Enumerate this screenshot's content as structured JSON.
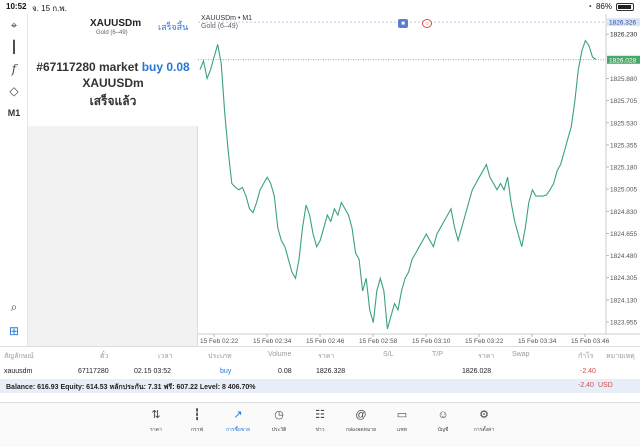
{
  "status": {
    "time": "10:52",
    "date": "จ. 15 ก.พ.",
    "battery": "86%"
  },
  "left_toolbar": {
    "tools": [
      "crosshair-icon",
      "candlestick-icon",
      "function-icon",
      "objects-icon"
    ],
    "timeframe": "M1"
  },
  "order_panel": {
    "symbol": "XAUUSDm",
    "symbol_desc": "Gold (6–49)",
    "done_label": "เสร็จสิ้น",
    "order_prefix": "#67117280 market",
    "order_type": "buy 0.08",
    "order_symbol": "XAUUSDm",
    "order_status": "เสร็จแล้ว"
  },
  "chart": {
    "header_line1": "XAUUSDm • M1",
    "header_line2": "Gold (6–49)",
    "current_price": "1826.028"
  },
  "chart_data": {
    "type": "line",
    "price_labels": [
      "1826.326",
      "1826.230",
      "1826.028",
      "1825.880",
      "1825.705",
      "1825.530",
      "1825.355",
      "1825.180",
      "1825.005",
      "1824.830",
      "1824.655",
      "1824.480",
      "1824.305",
      "1824.130",
      "1823.955"
    ],
    "time_labels": [
      "15 Feb 02:22",
      "15 Feb 02:34",
      "15 Feb 02:46",
      "15 Feb 02:58",
      "15 Feb 03:10",
      "15 Feb 03:22",
      "15 Feb 03:34",
      "15 Feb 03:46"
    ],
    "ylim": [
      1823.86,
      1826.39
    ],
    "price_ticks": [
      1826.23,
      1826.055,
      1825.88,
      1825.705,
      1825.53,
      1825.355,
      1825.18,
      1825.005,
      1824.83,
      1824.655,
      1824.48,
      1824.305,
      1824.13,
      1823.955
    ],
    "current_price": 1826.028,
    "series": [
      {
        "values": [
          1825.95,
          1826.02,
          1825.88,
          1825.95,
          1826.05,
          1826.15,
          1826.0,
          1825.6,
          1825.3,
          1825.05,
          1825.02,
          1825.0,
          1825.02,
          1824.95,
          1824.85,
          1824.82,
          1824.9,
          1825.0,
          1825.05,
          1825.1,
          1825.05,
          1824.95,
          1824.7,
          1824.6,
          1824.55,
          1824.45,
          1824.35,
          1824.3,
          1824.45,
          1824.7,
          1824.88,
          1824.8,
          1824.65,
          1824.55,
          1824.6,
          1824.7,
          1824.8,
          1824.75,
          1824.85,
          1824.8,
          1824.9,
          1824.85,
          1824.8,
          1824.7,
          1824.5,
          1824.45,
          1824.2,
          1824.3,
          1824.05,
          1823.95,
          1824.2,
          1824.3,
          1824.2,
          1823.9,
          1824.0,
          1824.1,
          1824.05,
          1824.2,
          1824.3,
          1824.35,
          1824.45,
          1824.5,
          1824.55,
          1824.6,
          1824.65,
          1824.6,
          1824.55,
          1824.65,
          1824.7,
          1824.75,
          1824.8,
          1824.85,
          1824.7,
          1824.6,
          1824.7,
          1824.8,
          1824.9,
          1825.0,
          1825.05,
          1825.1,
          1825.15,
          1825.2,
          1825.1,
          1825.05,
          1825.0,
          1825.05,
          1825.0,
          1825.1,
          1824.9,
          1824.75,
          1824.65,
          1824.55,
          1824.7,
          1824.9,
          1825.0,
          1824.95,
          1824.95,
          1824.95,
          1824.96,
          1825.0,
          1825.05,
          1825.15,
          1825.2,
          1825.3,
          1825.4,
          1825.5,
          1825.7,
          1825.95,
          1826.1,
          1826.18,
          1826.14,
          1826.05,
          1826.03
        ]
      }
    ]
  },
  "table": {
    "headers": [
      "สัญลักษณ์",
      "ตั๋ว",
      "เวลา",
      "ประเภท",
      "Volume",
      "ราคา",
      "S/L",
      "T/P",
      "ราคา",
      "Swap",
      "กำไร",
      "หมายเหตุ"
    ],
    "row": {
      "symbol": "xauusdm",
      "ticket": "67117280",
      "time": "02.15 03:52",
      "type": "buy",
      "volume": "0.08",
      "open_price": "1826.328",
      "sl": "",
      "tp": "",
      "price": "1826.028",
      "swap": "",
      "profit": "-2.40",
      "comment": ""
    },
    "balance": "Balance: 616.93 Equity: 614.53 หลักประกัน: 7.31 ฟรี: 607.22 Level: 8 406.70%",
    "balance_profit": "-2.40",
    "currency": "USD"
  },
  "nav": {
    "items": [
      {
        "label": "ราคา",
        "icon": "quotes-icon"
      },
      {
        "label": "กราฟ",
        "icon": "chart-icon"
      },
      {
        "label": "การซื้อขาย",
        "icon": "trade-icon"
      },
      {
        "label": "ประวัติ",
        "icon": "history-icon"
      },
      {
        "label": "ข่าว",
        "icon": "news-icon"
      },
      {
        "label": "กล่องจดหมาย",
        "icon": "mailbox-icon"
      },
      {
        "label": "แชท",
        "icon": "chat-icon"
      },
      {
        "label": "บัญชี",
        "icon": "account-icon"
      },
      {
        "label": "การตั้งค่า",
        "icon": "settings-icon"
      }
    ]
  },
  "colors": {
    "line": "#3aa37a",
    "accent": "#2577d6",
    "loss": "#d84a4a",
    "price_line": "#4aa86a"
  }
}
